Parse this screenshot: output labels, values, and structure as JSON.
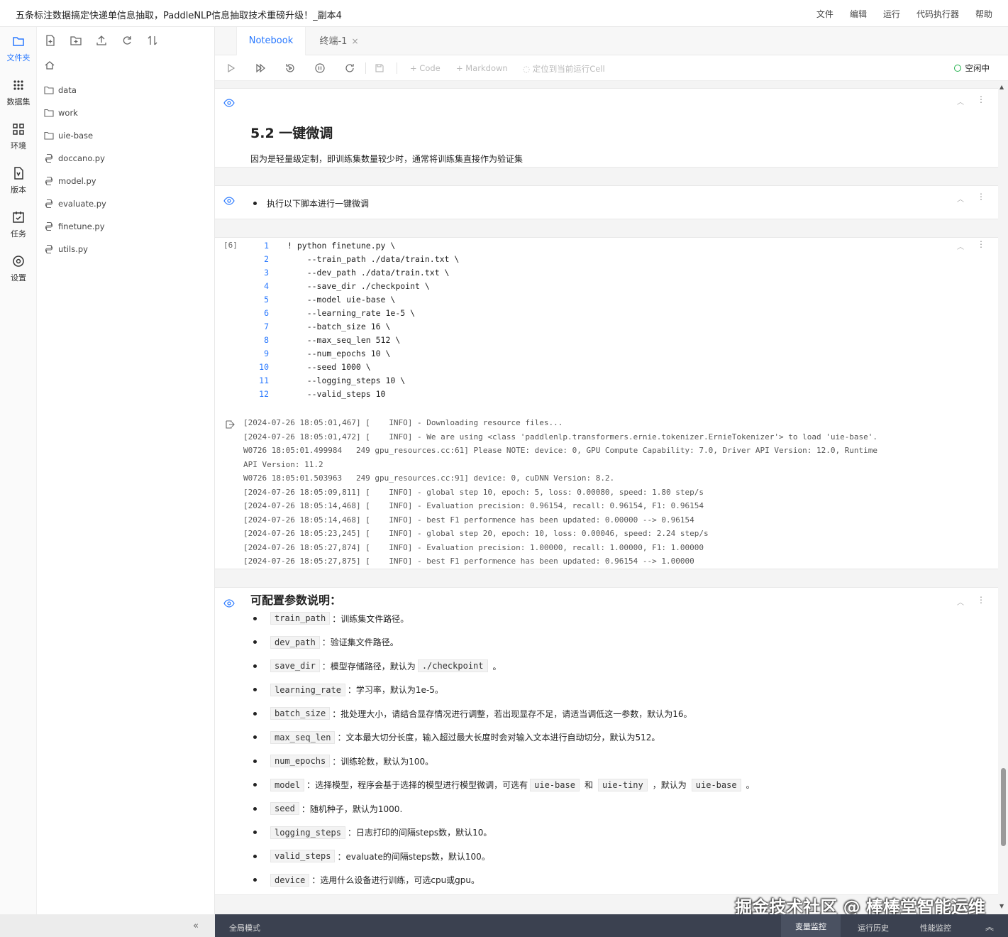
{
  "titlebar": {
    "title": "五条标注数据搞定快递单信息抽取，PaddleNLP信息抽取技术重磅升级！_副本4",
    "menu": [
      "文件",
      "编辑",
      "运行",
      "代码执行器",
      "帮助"
    ]
  },
  "rail": [
    {
      "label": "文件夹",
      "icon": "folder-icon",
      "active": true
    },
    {
      "label": "数据集",
      "icon": "dataset-icon",
      "active": false
    },
    {
      "label": "环境",
      "icon": "environment-icon",
      "active": false
    },
    {
      "label": "版本",
      "icon": "version-icon",
      "active": false
    },
    {
      "label": "任务",
      "icon": "task-icon",
      "active": false
    },
    {
      "label": "设置",
      "icon": "settings-icon",
      "active": false
    }
  ],
  "files": [
    {
      "name": "data",
      "type": "folder"
    },
    {
      "name": "work",
      "type": "folder"
    },
    {
      "name": "uie-base",
      "type": "folder"
    },
    {
      "name": "doccano.py",
      "type": "python"
    },
    {
      "name": "model.py",
      "type": "python"
    },
    {
      "name": "evaluate.py",
      "type": "python"
    },
    {
      "name": "finetune.py",
      "type": "python"
    },
    {
      "name": "utils.py",
      "type": "python"
    }
  ],
  "tabs": {
    "notebook": "Notebook",
    "terminal": "终端-1",
    "close": "×"
  },
  "toolbar": {
    "add_code": "+ Code",
    "add_markdown": "+ Markdown",
    "locate": "定位到当前运行Cell",
    "status": "空闲中",
    "status_color": "#22b14c"
  },
  "cells": {
    "md1": {
      "heading": "5.2 一键微调",
      "text": "因为是轻量级定制，即训练集数量较少时，通常将训练集直接作为验证集"
    },
    "md2": {
      "bullet": "执行以下脚本进行一键微调"
    },
    "code": {
      "exec_count": "[6]",
      "lines": [
        "! python finetune.py \\",
        "    --train_path ./data/train.txt \\",
        "    --dev_path ./data/train.txt \\",
        "    --save_dir ./checkpoint \\",
        "    --model uie-base \\",
        "    --learning_rate 1e-5 \\",
        "    --batch_size 16 \\",
        "    --max_seq_len 512 \\",
        "    --num_epochs 10 \\",
        "    --seed 1000 \\",
        "    --logging_steps 10 \\",
        "    --valid_steps 10"
      ],
      "output": [
        "[2024-07-26 18:05:01,467] [    INFO] - Downloading resource files...",
        "[2024-07-26 18:05:01,472] [    INFO] - We are using <class 'paddlenlp.transformers.ernie.tokenizer.ErnieTokenizer'> to load 'uie-base'.",
        "W0726 18:05:01.499984   249 gpu_resources.cc:61] Please NOTE: device: 0, GPU Compute Capability: 7.0, Driver API Version: 12.0, Runtime",
        "API Version: 11.2",
        "W0726 18:05:01.503963   249 gpu_resources.cc:91] device: 0, cuDNN Version: 8.2.",
        "[2024-07-26 18:05:09,811] [    INFO] - global step 10, epoch: 5, loss: 0.00080, speed: 1.80 step/s",
        "[2024-07-26 18:05:14,468] [    INFO] - Evaluation precision: 0.96154, recall: 0.96154, F1: 0.96154",
        "[2024-07-26 18:05:14,468] [    INFO] - best F1 performence has been updated: 0.00000 --> 0.96154",
        "[2024-07-26 18:05:23,245] [    INFO] - global step 20, epoch: 10, loss: 0.00046, speed: 2.24 step/s",
        "[2024-07-26 18:05:27,874] [    INFO] - Evaluation precision: 1.00000, recall: 1.00000, F1: 1.00000",
        "[2024-07-26 18:05:27,875] [    INFO] - best F1 performence has been updated: 0.96154 --> 1.00000"
      ]
    },
    "params": {
      "title": "可配置参数说明：",
      "items": [
        {
          "key": "train_path",
          "desc": "：训练集文件路径。"
        },
        {
          "key": "dev_path",
          "desc": "：验证集文件路径。"
        },
        {
          "key": "save_dir",
          "desc": "：模型存储路径，默认为",
          "extra": [
            {
              "code": "./checkpoint"
            },
            {
              "text": "。"
            }
          ]
        },
        {
          "key": "learning_rate",
          "desc": "：学习率，默认为1e-5。"
        },
        {
          "key": "batch_size",
          "desc": "：批处理大小，请结合显存情况进行调整，若出现显存不足，请适当调低这一参数，默认为16。"
        },
        {
          "key": "max_seq_len",
          "desc": "：文本最大切分长度，输入超过最大长度时会对输入文本进行自动切分，默认为512。"
        },
        {
          "key": "num_epochs",
          "desc": "：训练轮数，默认为100。"
        },
        {
          "key": "model",
          "desc": "：选择模型，程序会基于选择的模型进行模型微调，可选有",
          "extra": [
            {
              "code": "uie-base"
            },
            {
              "text": "和"
            },
            {
              "code": "uie-tiny"
            },
            {
              "text": "，默认为"
            },
            {
              "code": "uie-base"
            },
            {
              "text": "。"
            }
          ]
        },
        {
          "key": "seed",
          "desc": "：随机种子，默认为1000."
        },
        {
          "key": "logging_steps",
          "desc": "：日志打印的间隔steps数，默认10。"
        },
        {
          "key": "valid_steps",
          "desc": "：evaluate的间隔steps数，默认100。"
        },
        {
          "key": "device",
          "desc": "：选用什么设备进行训练，可选cpu或gpu。"
        }
      ]
    }
  },
  "bottombar": {
    "collapse": "«",
    "mode": "全局模式",
    "tabs": [
      "变量监控",
      "运行历史",
      "性能监控"
    ],
    "expand": "︽"
  },
  "watermark": "掘金技术社区 @ 棒棒堂智能运维",
  "colors": {
    "accent": "#2878ff",
    "bottombar": "#3b4150"
  }
}
